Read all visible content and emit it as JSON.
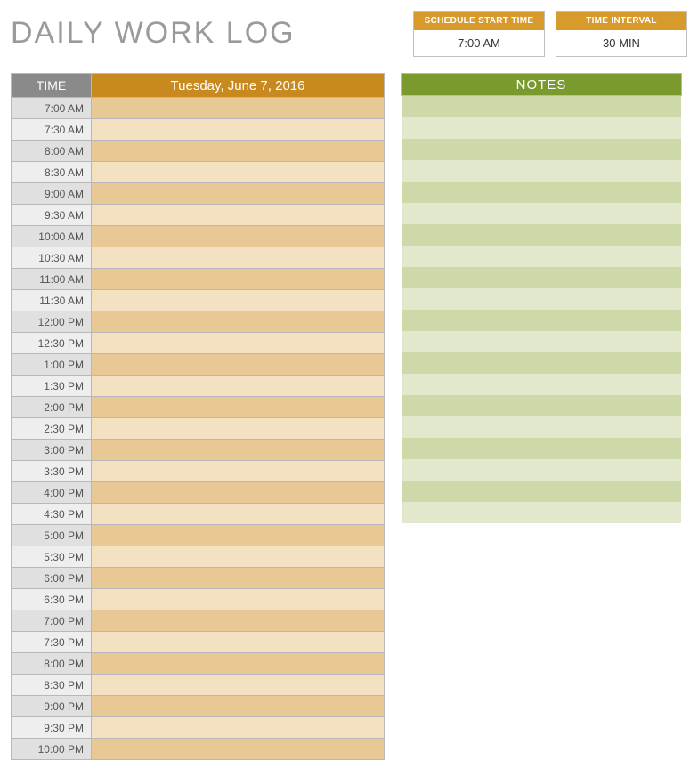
{
  "title": "DAILY WORK LOG",
  "config": {
    "start_time": {
      "label": "SCHEDULE START TIME",
      "value": "7:00 AM"
    },
    "interval": {
      "label": "TIME INTERVAL",
      "value": "30 MIN"
    }
  },
  "schedule": {
    "time_header": "TIME",
    "date_header": "Tuesday, June 7, 2016",
    "slots": [
      "7:00 AM",
      "7:30 AM",
      "8:00 AM",
      "8:30 AM",
      "9:00 AM",
      "9:30 AM",
      "10:00 AM",
      "10:30 AM",
      "11:00 AM",
      "11:30 AM",
      "12:00 PM",
      "12:30 PM",
      "1:00 PM",
      "1:30 PM",
      "2:00 PM",
      "2:30 PM",
      "3:00 PM",
      "3:30 PM",
      "4:00 PM",
      "4:30 PM",
      "5:00 PM",
      "5:30 PM",
      "6:00 PM",
      "6:30 PM",
      "7:00 PM",
      "7:30 PM",
      "8:00 PM",
      "8:30 PM",
      "9:00 PM",
      "9:30 PM",
      "10:00 PM"
    ]
  },
  "notes": {
    "header": "NOTES",
    "row_count": 20
  }
}
